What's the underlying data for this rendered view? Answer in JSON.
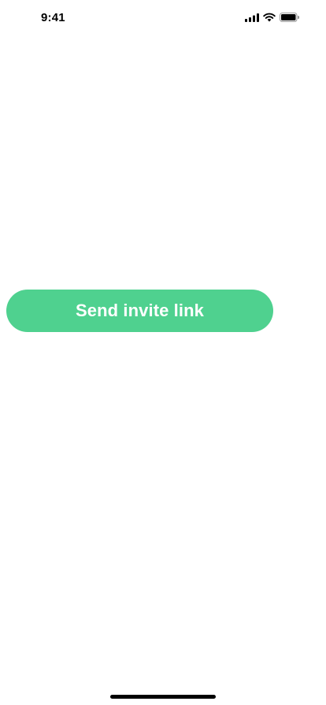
{
  "status_bar": {
    "time": "9:41",
    "icons": [
      "cellular-signal-icon",
      "wifi-icon",
      "battery-icon"
    ]
  },
  "main": {
    "invite_button_label": "Send invite link"
  },
  "colors": {
    "accent": "#4fd18f",
    "button_text": "#ffffff",
    "background": "#ffffff"
  }
}
